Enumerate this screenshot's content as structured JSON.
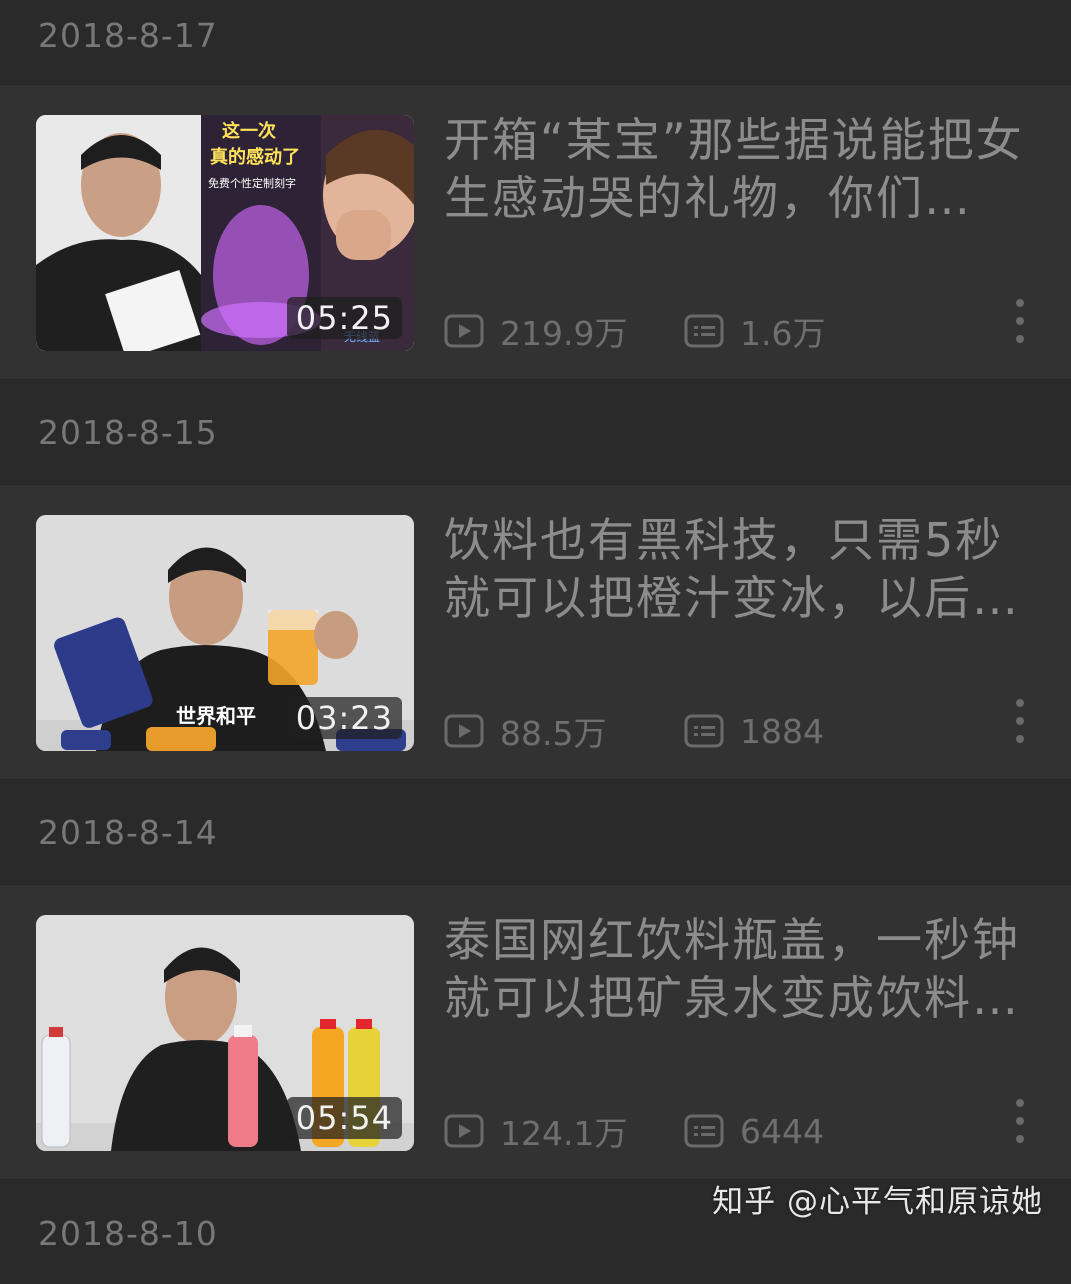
{
  "feed": [
    {
      "date": "2018-8-17",
      "title": "开箱“某宝”那些据说能把女生感动哭的礼物，你们…",
      "duration": "05:25",
      "views": "219.9万",
      "comments": "1.6万",
      "thumb_text": {
        "line1": "这一次",
        "line2": "真的感动了",
        "line3": "免费个性定制刻字",
        "badge": "无线蓝"
      }
    },
    {
      "date": "2018-8-15",
      "title": "饮料也有黑科技，只需5秒就可以把橙汁变冰，以后…",
      "duration": "03:23",
      "views": "88.5万",
      "comments": "1884",
      "thumb_text": {
        "shirt": "世界和平"
      }
    },
    {
      "date": "2018-8-14",
      "title": "泰国网红饮料瓶盖，一秒钟就可以把矿泉水变成饮料…",
      "duration": "05:54",
      "views": "124.1万",
      "comments": "6444",
      "thumb_text": {}
    }
  ],
  "next_date": "2018-8-10",
  "watermark": "知乎 @心平气和原谅她",
  "icons": {
    "views": "play-icon",
    "comments": "comment-icon",
    "more": "more-vertical-icon"
  },
  "colors": {
    "background": "#2a2a2a",
    "card": "#323232",
    "text": "#8c8c8c",
    "meta": "#6f6f6f"
  }
}
